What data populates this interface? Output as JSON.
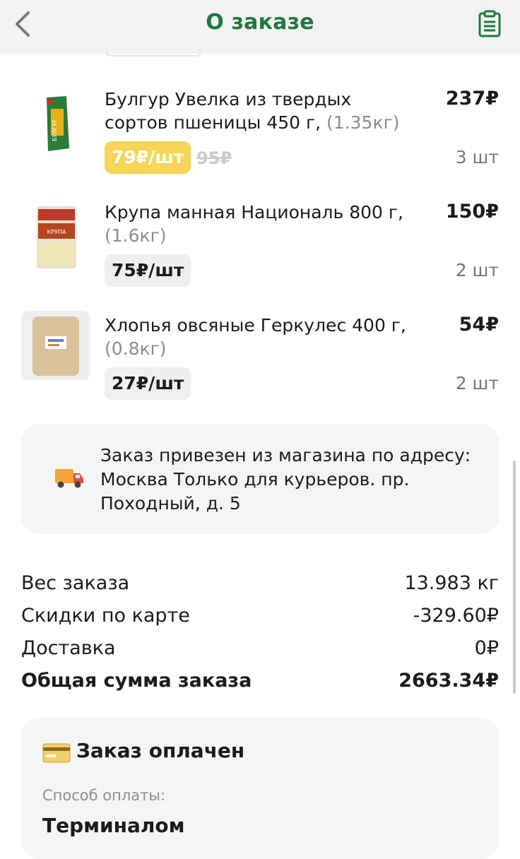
{
  "header": {
    "title": "О заказе"
  },
  "items": [
    {
      "name": "Булгур Увелка из твердых сортов пшеницы 450 г,",
      "weight": "(1.35кг)",
      "price": "237₽",
      "unit_price": "79₽/шт",
      "old_price": "95₽",
      "qty": "3 шт",
      "promo": true
    },
    {
      "name": "Крупа манная Националь 800 г,",
      "weight": "(1.6кг)",
      "price": "150₽",
      "unit_price": "75₽/шт",
      "qty": "2 шт"
    },
    {
      "name": "Хлопья овсяные Геркулес 400 г,",
      "weight": "(0.8кг)",
      "price": "54₽",
      "unit_price": "27₽/шт",
      "qty": "2 шт"
    }
  ],
  "delivery": {
    "text": "Заказ привезен из магазина по адресу: Москва Только для курьеров. пр. Походный, д. 5"
  },
  "summary": {
    "weight_label": "Вес заказа",
    "weight_value": "13.983 кг",
    "discount_label": "Скидки по карте",
    "discount_value": "-329.60₽",
    "delivery_label": "Доставка",
    "delivery_value": "0₽",
    "total_label": "Общая сумма заказа",
    "total_value": "2663.34₽"
  },
  "payment": {
    "status": "Заказ оплачен",
    "method_label": "Способ оплаты:",
    "method_value": "Терминалом"
  },
  "colors": {
    "accent": "#1e7a3b",
    "promo": "#f8d557",
    "card_bg": "#f5f5f5"
  }
}
